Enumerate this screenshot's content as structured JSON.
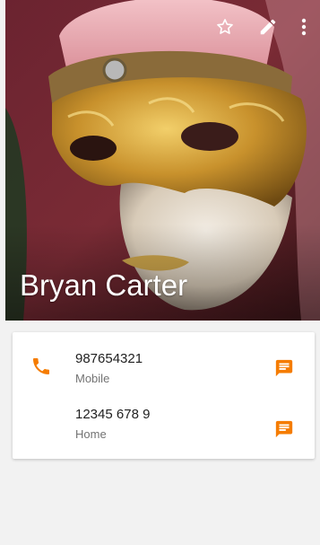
{
  "contact": {
    "name": "Bryan Carter"
  },
  "toolbar": {
    "icons": [
      "star-outline-icon",
      "edit-pencil-icon",
      "more-vert-icon"
    ]
  },
  "phones": [
    {
      "number": "987654321",
      "label": "Mobile",
      "icon": "phone-icon",
      "action_icon": "message-icon"
    },
    {
      "number": "12345 678 9",
      "label": "Home",
      "action_icon": "message-icon"
    }
  ],
  "colors": {
    "accent": "#f57c00",
    "background": "#f2f2f2",
    "card": "#ffffff"
  }
}
